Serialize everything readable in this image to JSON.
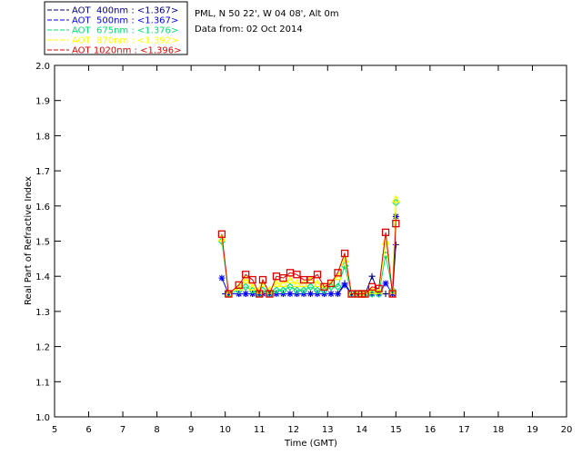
{
  "header": {
    "station": "PML, N 50 22', W 04 08', Alt 0m",
    "date": "Data from: 02 Oct 2014"
  },
  "chart_data": {
    "type": "line",
    "xlabel": "Time (GMT)",
    "ylabel": "Real Part of Refractive Index",
    "xlim": [
      5,
      20
    ],
    "ylim": [
      1.0,
      2.0
    ],
    "xticks": [
      5,
      6,
      7,
      8,
      9,
      10,
      11,
      12,
      13,
      14,
      15,
      16,
      17,
      18,
      19,
      20
    ],
    "yticks": [
      "1.0",
      "1.1",
      "1.2",
      "1.3",
      "1.4",
      "1.5",
      "1.6",
      "1.7",
      "1.8",
      "1.9",
      "2.0"
    ],
    "legend_position": "top-left",
    "grid": false,
    "series": [
      {
        "name": "AOT  400nm : <1.367>",
        "color": "#000080",
        "marker": "plus",
        "x": [
          10.0,
          10.1,
          10.4,
          10.6,
          10.8,
          11.0,
          11.1,
          11.3,
          11.5,
          11.7,
          11.9,
          12.1,
          12.3,
          12.5,
          12.7,
          12.9,
          13.1,
          13.3,
          13.5,
          13.7,
          13.9,
          14.0,
          14.1,
          14.3,
          14.5,
          14.7,
          14.9,
          15.0
        ],
        "y": [
          1.35,
          1.35,
          1.35,
          1.35,
          1.35,
          1.35,
          1.35,
          1.35,
          1.35,
          1.35,
          1.35,
          1.35,
          1.35,
          1.35,
          1.35,
          1.35,
          1.35,
          1.35,
          1.38,
          1.35,
          1.35,
          1.35,
          1.35,
          1.4,
          1.35,
          1.35,
          1.35,
          1.49
        ]
      },
      {
        "name": "AOT  500nm : <1.367>",
        "color": "#0000ff",
        "marker": "asterisk",
        "x": [
          9.9,
          10.1,
          10.4,
          10.6,
          10.8,
          11.0,
          11.1,
          11.3,
          11.5,
          11.7,
          11.9,
          12.1,
          12.3,
          12.5,
          12.7,
          12.9,
          13.1,
          13.3,
          13.5,
          13.7,
          13.9,
          14.0,
          14.1,
          14.3,
          14.5,
          14.7,
          14.9,
          15.0
        ],
        "y": [
          1.395,
          1.35,
          1.35,
          1.35,
          1.35,
          1.35,
          1.35,
          1.35,
          1.35,
          1.35,
          1.35,
          1.35,
          1.35,
          1.35,
          1.35,
          1.35,
          1.35,
          1.35,
          1.375,
          1.35,
          1.35,
          1.35,
          1.35,
          1.35,
          1.35,
          1.38,
          1.35,
          1.57
        ]
      },
      {
        "name": "AOT  675nm : <1.376>",
        "color": "#00e070",
        "marker": "diamond",
        "x": [
          9.9,
          10.1,
          10.4,
          10.6,
          10.8,
          11.0,
          11.1,
          11.3,
          11.5,
          11.7,
          11.9,
          12.1,
          12.3,
          12.5,
          12.7,
          12.9,
          13.1,
          13.3,
          13.5,
          13.7,
          13.9,
          14.0,
          14.1,
          14.3,
          14.5,
          14.7,
          14.9,
          15.0
        ],
        "y": [
          1.5,
          1.35,
          1.36,
          1.37,
          1.36,
          1.35,
          1.36,
          1.35,
          1.36,
          1.36,
          1.37,
          1.36,
          1.36,
          1.37,
          1.36,
          1.36,
          1.37,
          1.37,
          1.43,
          1.35,
          1.35,
          1.35,
          1.35,
          1.35,
          1.35,
          1.46,
          1.36,
          1.61
        ]
      },
      {
        "name": "AOT  870nm : <1.392>",
        "color": "#ffff00",
        "marker": "triangle",
        "x": [
          9.9,
          10.1,
          10.4,
          10.6,
          10.8,
          11.0,
          11.1,
          11.3,
          11.5,
          11.7,
          11.9,
          12.1,
          12.3,
          12.5,
          12.7,
          12.9,
          13.1,
          13.3,
          13.5,
          13.7,
          13.9,
          14.0,
          14.1,
          14.3,
          14.5,
          14.7,
          14.9,
          15.0
        ],
        "y": [
          1.51,
          1.35,
          1.37,
          1.39,
          1.37,
          1.36,
          1.38,
          1.36,
          1.38,
          1.38,
          1.39,
          1.38,
          1.38,
          1.39,
          1.38,
          1.37,
          1.38,
          1.4,
          1.45,
          1.35,
          1.35,
          1.35,
          1.35,
          1.36,
          1.36,
          1.5,
          1.36,
          1.62
        ]
      },
      {
        "name": "AOT 1020nm : <1.396>",
        "color": "#e00000",
        "marker": "square",
        "x": [
          9.9,
          10.1,
          10.4,
          10.6,
          10.8,
          11.0,
          11.1,
          11.3,
          11.5,
          11.7,
          11.9,
          12.1,
          12.3,
          12.5,
          12.7,
          12.9,
          13.1,
          13.3,
          13.5,
          13.7,
          13.9,
          14.0,
          14.1,
          14.3,
          14.5,
          14.7,
          14.9,
          15.0
        ],
        "y": [
          1.52,
          1.35,
          1.375,
          1.405,
          1.39,
          1.35,
          1.39,
          1.35,
          1.4,
          1.395,
          1.41,
          1.405,
          1.39,
          1.39,
          1.405,
          1.37,
          1.38,
          1.41,
          1.465,
          1.35,
          1.35,
          1.35,
          1.35,
          1.37,
          1.365,
          1.525,
          1.35,
          1.55
        ]
      }
    ]
  }
}
